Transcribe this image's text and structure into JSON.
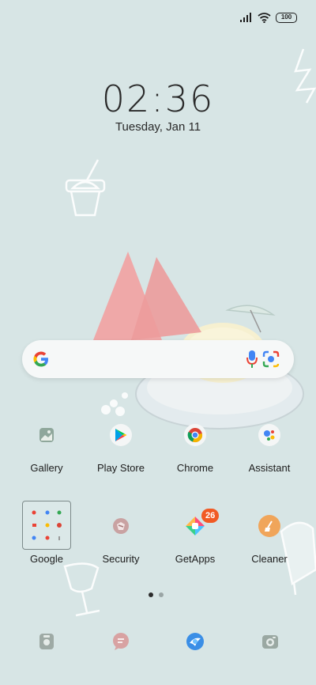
{
  "status_bar": {
    "battery": "100",
    "icons": [
      "signal-icon",
      "wifi-icon",
      "battery-icon"
    ]
  },
  "lock": {
    "time": "02:36",
    "date": "Tuesday, Jan 11"
  },
  "search_bar": {
    "icons": [
      "google-g-icon",
      "microphone-icon",
      "lens-camera-icon"
    ]
  },
  "apps_row1": [
    {
      "label": "Gallery",
      "icon": "gallery-icon"
    },
    {
      "label": "Play Store",
      "icon": "play-store-icon"
    },
    {
      "label": "Chrome",
      "icon": "chrome-icon"
    },
    {
      "label": "Assistant",
      "icon": "assistant-icon"
    }
  ],
  "apps_row2": [
    {
      "label": "Google",
      "icon": "folder-icon"
    },
    {
      "label": "Security",
      "icon": "security-icon"
    },
    {
      "label": "GetApps",
      "icon": "getapps-icon",
      "badge": "26"
    },
    {
      "label": "Cleaner",
      "icon": "cleaner-icon"
    }
  ],
  "page_indicator": {
    "pages": 2,
    "current": 1
  },
  "dock": [
    {
      "icon": "phone-icon"
    },
    {
      "icon": "messages-icon"
    },
    {
      "icon": "browser-icon"
    },
    {
      "icon": "camera-icon"
    }
  ],
  "colors": {
    "background": "#d7e5e5",
    "badge": "#f15a24",
    "watermelon": "#f1a3a3"
  }
}
